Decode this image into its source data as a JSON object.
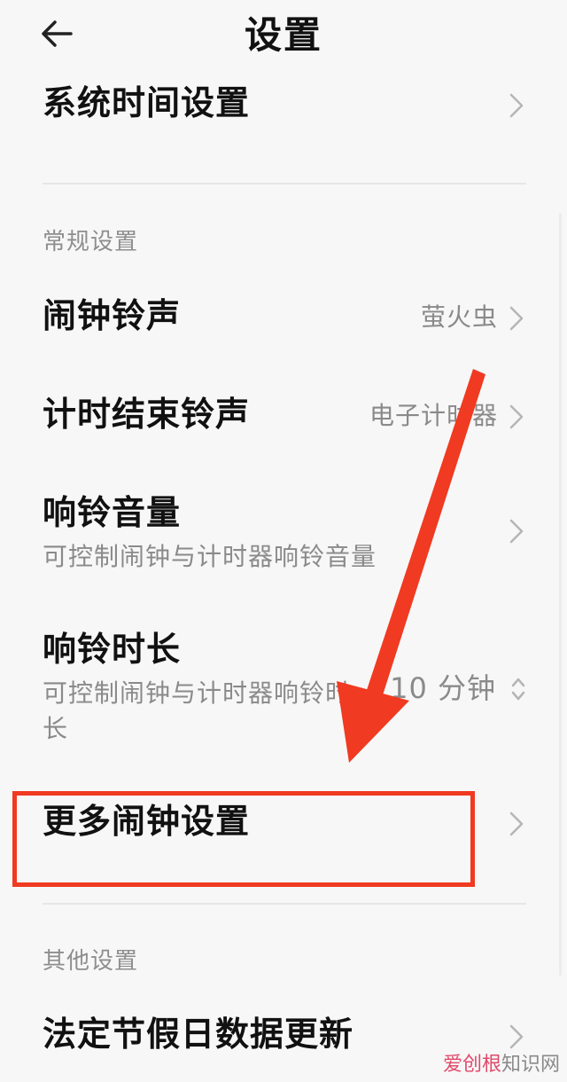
{
  "header": {
    "title": "设置"
  },
  "rows": {
    "system_time": {
      "label": "系统时间设置"
    },
    "alarm_ringtone": {
      "label": "闹钟铃声",
      "value": "萤火虫"
    },
    "timer_end_ringtone": {
      "label": "计时结束铃声",
      "value": "电子计时器"
    },
    "ring_volume": {
      "label": "响铃音量",
      "sub": "可控制闹钟与计时器响铃音量"
    },
    "ring_duration": {
      "label": "响铃时长",
      "sub_line1": "可控制闹钟与计时器响铃时",
      "sub_line2": "长",
      "value": "10 分钟"
    },
    "more_alarm": {
      "label": "更多闹钟设置"
    },
    "holiday_update": {
      "label": "法定节假日数据更新"
    }
  },
  "sections": {
    "general": "常规设置",
    "other": "其他设置"
  },
  "watermark": {
    "brand": "爱创根",
    "suffix": "知识网"
  },
  "colors": {
    "annotation_red": "#f03a21",
    "secondary_text": "#8a8a8a"
  }
}
